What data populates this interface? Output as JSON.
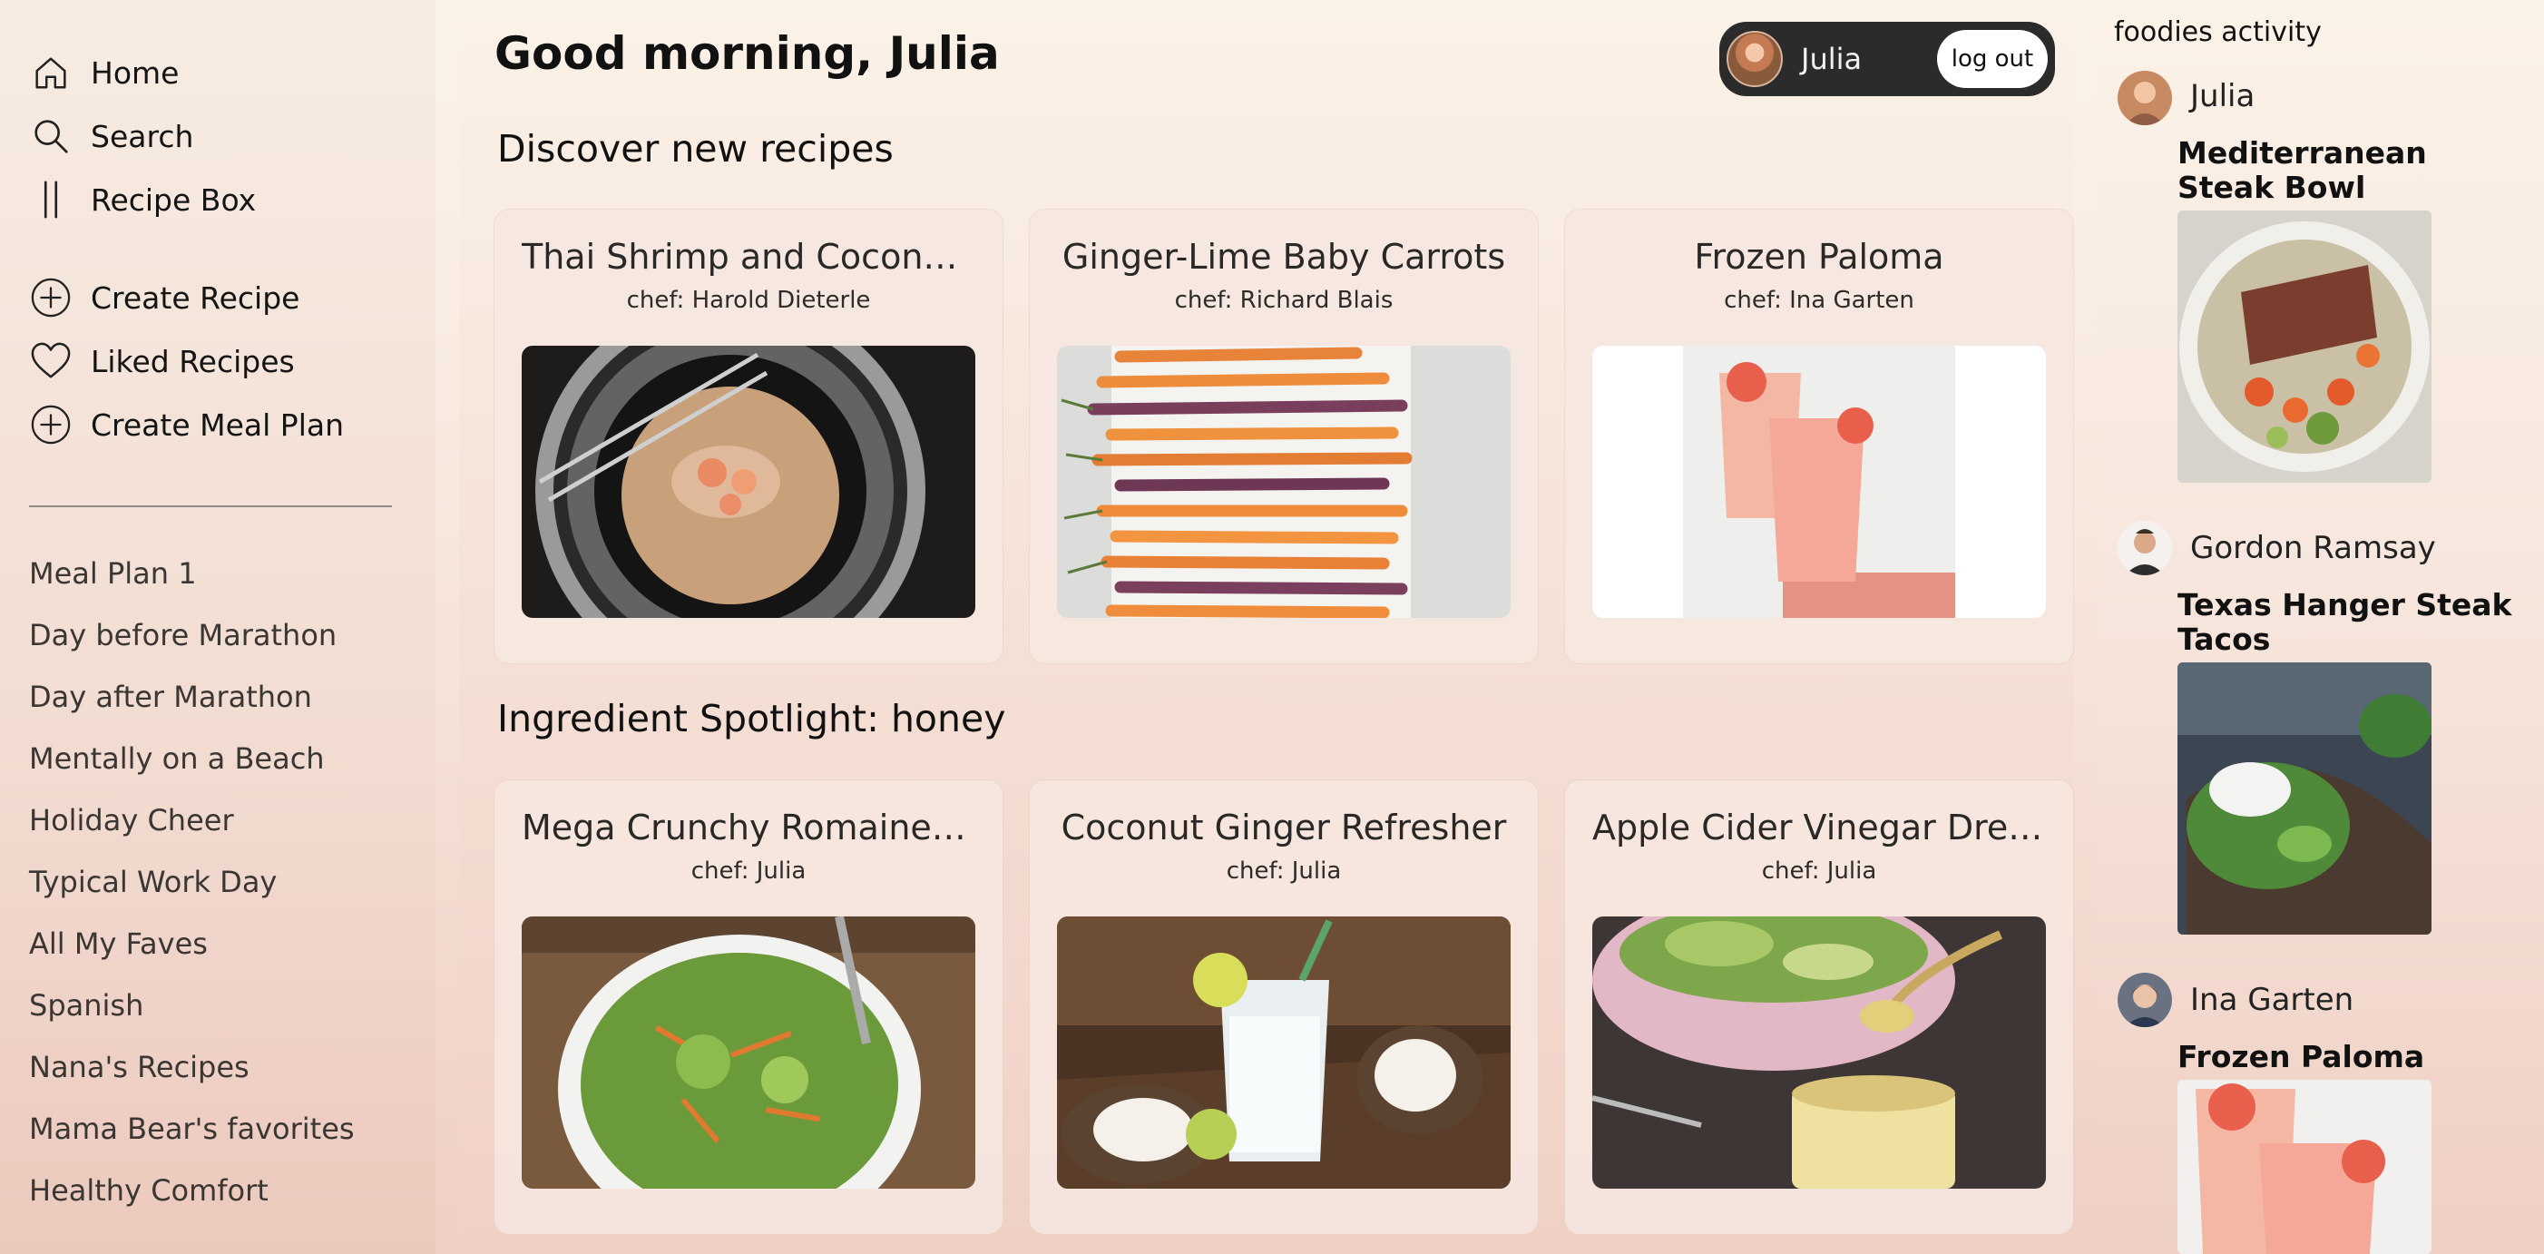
{
  "nav": {
    "home": "Home",
    "search": "Search",
    "recipe_box": "Recipe Box",
    "create_recipe": "Create Recipe",
    "liked_recipes": "Liked Recipes",
    "create_meal_plan": "Create Meal Plan"
  },
  "meal_plans": [
    "Meal Plan 1",
    "Day before Marathon",
    "Day after Marathon",
    "Mentally on a Beach",
    "Holiday Cheer",
    "Typical Work Day",
    "All My Faves",
    "Spanish",
    "Nana's Recipes",
    "Mama Bear's favorites",
    "Healthy Comfort"
  ],
  "header": {
    "greeting": "Good morning, Julia",
    "user_name": "Julia",
    "logout_label": "log out"
  },
  "sections": {
    "discover_title": "Discover new recipes",
    "spotlight_title": "Ingredient Spotlight: honey"
  },
  "discover": [
    {
      "title": "Thai Shrimp and Coconu...",
      "chef": "chef: Harold Dieterle"
    },
    {
      "title": "Ginger-Lime Baby Carrots",
      "chef": "chef: Richard Blais"
    },
    {
      "title": "Frozen Paloma",
      "chef": "chef: Ina Garten"
    }
  ],
  "spotlight": [
    {
      "title": "Mega Crunchy Romaine ...",
      "chef": "chef: Julia"
    },
    {
      "title": "Coconut Ginger Refresher",
      "chef": "chef: Julia"
    },
    {
      "title": "Apple Cider Vinegar Dres...",
      "chef": "chef: Julia"
    }
  ],
  "activity": {
    "heading": "foodies activity",
    "items": [
      {
        "user": "Julia",
        "recipe": "Mediterranean Steak Bowl"
      },
      {
        "user": "Gordon Ramsay",
        "recipe": "Texas Hanger Steak Tacos"
      },
      {
        "user": "Ina Garten",
        "recipe": "Frozen Paloma"
      }
    ]
  },
  "colors": {
    "pill_bg": "#2b2b2b",
    "card_bg": "#f6e7e0",
    "divider": "#8f8a87"
  },
  "icons": [
    "home-icon",
    "search-icon",
    "recipe-box-icon",
    "plus-circle-icon",
    "heart-icon",
    "plus-circle-icon"
  ]
}
